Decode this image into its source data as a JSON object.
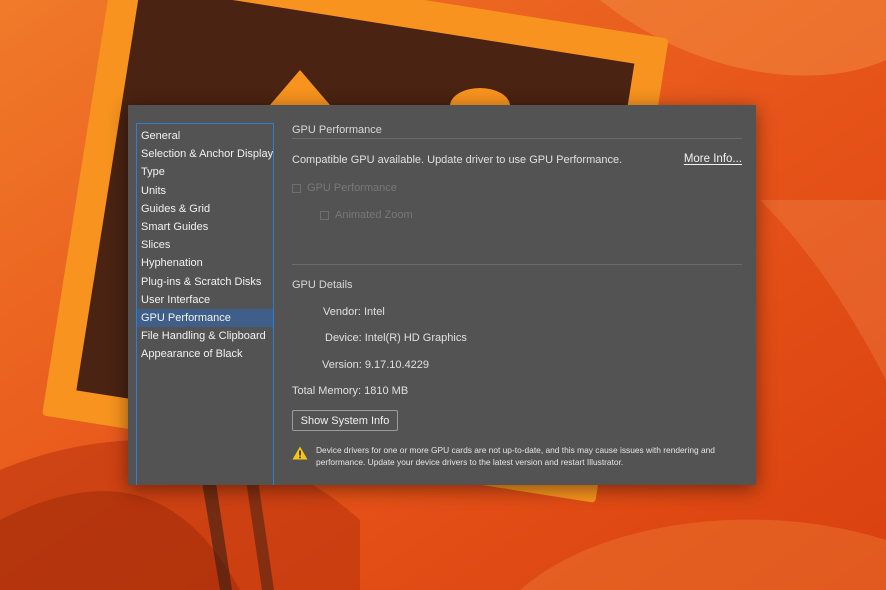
{
  "colors": {
    "background_orange": "#e85a16",
    "frame_orange": "#f7931e",
    "dialog_bg": "#535353",
    "selection_blue": "#3f5f8a",
    "focus_border": "#2f7fd0",
    "warning_yellow": "#f5c518"
  },
  "sidebar": {
    "items": [
      {
        "label": "General"
      },
      {
        "label": "Selection & Anchor Display"
      },
      {
        "label": "Type"
      },
      {
        "label": "Units"
      },
      {
        "label": "Guides & Grid"
      },
      {
        "label": "Smart Guides"
      },
      {
        "label": "Slices"
      },
      {
        "label": "Hyphenation"
      },
      {
        "label": "Plug-ins & Scratch Disks"
      },
      {
        "label": "User Interface"
      },
      {
        "label": "GPU Performance",
        "selected": true
      },
      {
        "label": "File Handling & Clipboard"
      },
      {
        "label": "Appearance of Black"
      }
    ]
  },
  "gpu_performance": {
    "title": "GPU Performance",
    "status_text": "Compatible GPU available. Update driver to use GPU Performance.",
    "more_info_label": "More Info...",
    "gpu_checkbox_label": "GPU Performance",
    "gpu_checkbox_checked": false,
    "animated_zoom_label": "Animated Zoom",
    "animated_zoom_checked": false
  },
  "gpu_details": {
    "title": "GPU Details",
    "vendor_label": "Vendor:",
    "vendor_value": "Intel",
    "device_label": "Device:",
    "device_value": "Intel(R) HD Graphics",
    "version_label": "Version:",
    "version_value": "9.17.10.4229",
    "memory_label": "Total Memory:",
    "memory_value": "1810 MB",
    "show_system_info_label": "Show System Info",
    "warning_text": "Device drivers for one or more GPU cards are not up-to-date, and this may cause issues with rendering and performance. Update your device drivers to the latest version and restart Illustrator.",
    "warning_icon": "warning-triangle-icon"
  }
}
